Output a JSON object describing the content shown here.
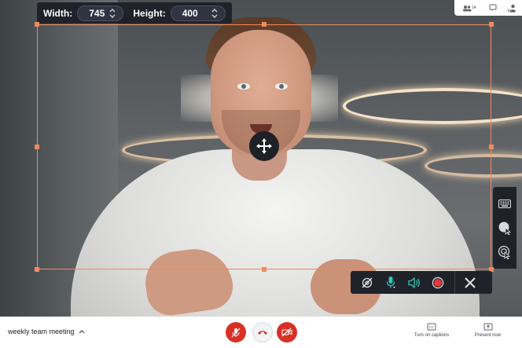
{
  "size_bar": {
    "width_label": "Width:",
    "width_value": "745",
    "height_label": "Height:",
    "height_value": "400"
  },
  "top_right": {
    "participants_count": "14",
    "you_label": "You"
  },
  "side_tools": {
    "icons": [
      "keyboard-icon",
      "cursor-highlight-icon",
      "click-ripple-icon"
    ]
  },
  "record_tools": {
    "icons": [
      "camera-off-icon",
      "microphone-icon",
      "speaker-icon",
      "record-icon",
      "close-icon"
    ],
    "record_color": "#e53935"
  },
  "bottom_bar": {
    "meeting_name": "weekly team meeting",
    "captions_label": "Turn on captions",
    "present_label": "Present now"
  },
  "colors": {
    "accent": "#f08a5d",
    "danger": "#d93025",
    "toolbar_bg": "#1f2329"
  }
}
